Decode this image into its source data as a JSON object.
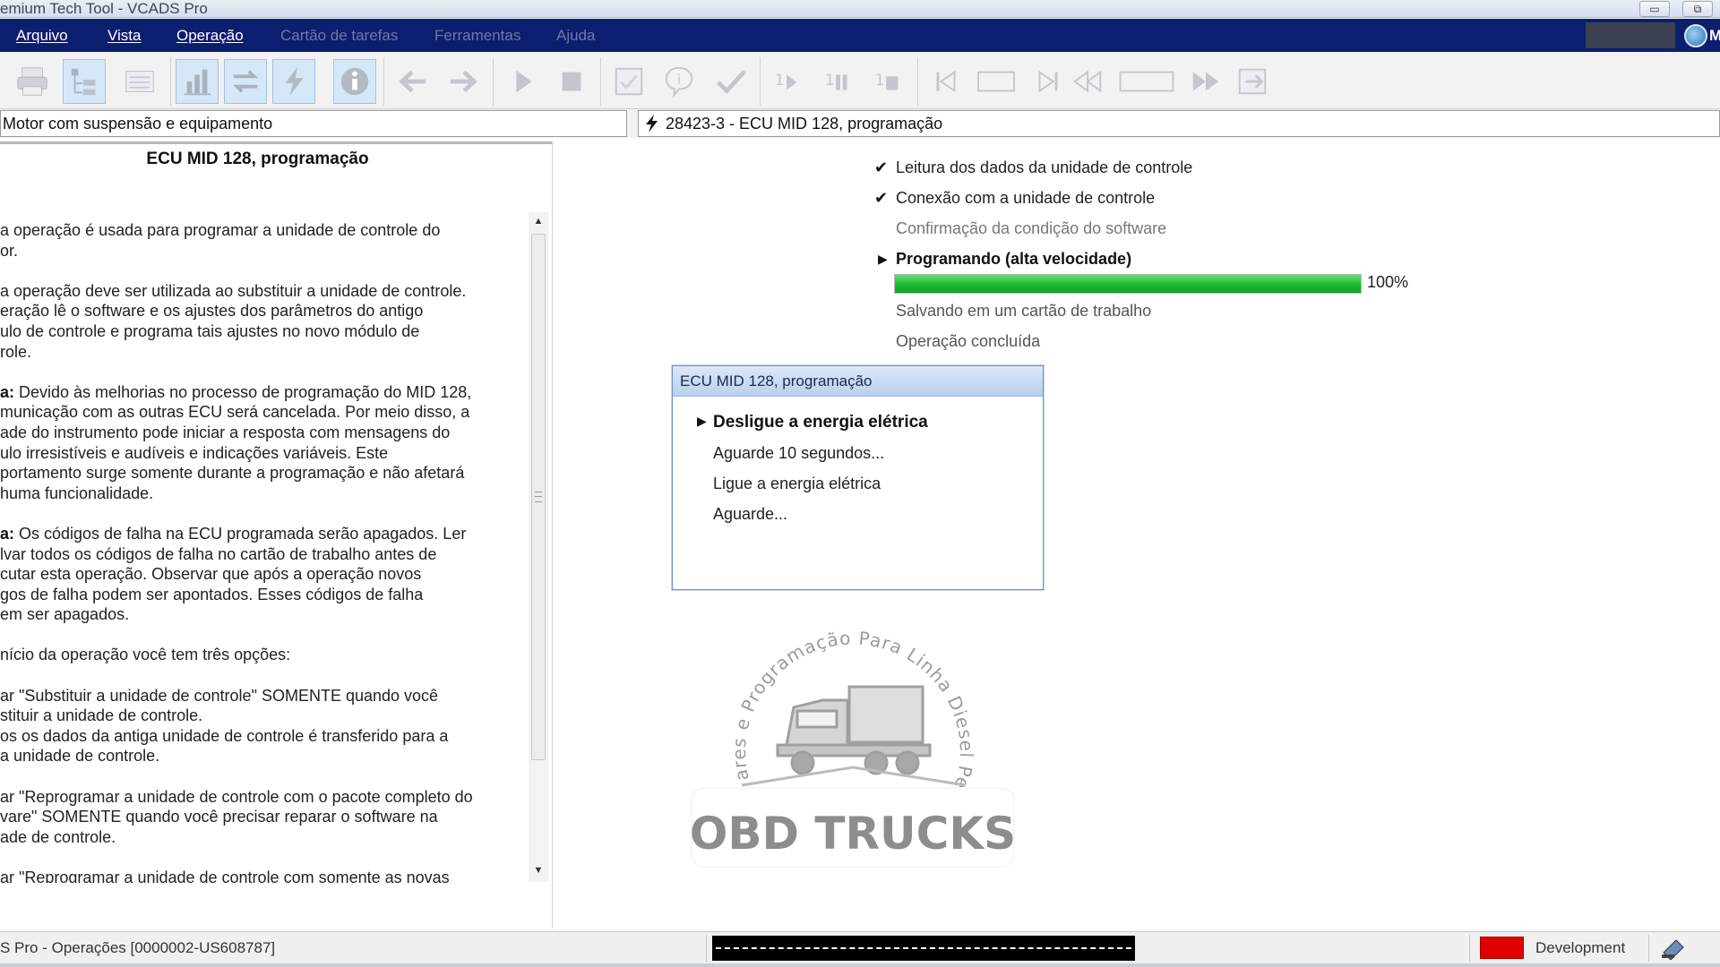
{
  "window": {
    "title": "emium Tech Tool - VCADS Pro",
    "minimize_label": "▭",
    "restore_label": "⧉"
  },
  "menu": {
    "items": [
      "Arquivo",
      "Vista",
      "Operação",
      "Cartão de tarefas",
      "Ferramentas",
      "Ajuda"
    ],
    "enabled": [
      true,
      true,
      true,
      false,
      false,
      false
    ],
    "right_letter": "M"
  },
  "toolbar": {
    "icons": [
      "printer-icon",
      "tree-icon",
      "list-icon",
      "bar-chart-icon",
      "swap-arrows-icon",
      "bolt-icon",
      "info-icon",
      "back-arrow-icon",
      "forward-arrow-icon",
      "play-icon",
      "stop-icon",
      "checklist-icon",
      "hint-icon",
      "checkmark-icon",
      "step-play-icon",
      "step-pause-icon",
      "step-stop-icon",
      "first-icon",
      "frame-icon",
      "last-icon",
      "rewind-icon",
      "frame2-icon",
      "fast-forward-icon",
      "export-icon"
    ],
    "active": [
      "tree-icon",
      "bar-chart-icon",
      "swap-arrows-icon",
      "bolt-icon",
      "info-icon"
    ]
  },
  "breadcrumb": {
    "left": "Motor com suspensão e equipamento",
    "right": "28423-3 - ECU MID 128, programação"
  },
  "document": {
    "title": "ECU MID 128, programação",
    "lines": [
      [
        "a operação é usada para programar a unidade de controle do",
        "or."
      ],
      [
        "a operação deve ser utilizada ao substituir a unidade de controle.",
        "eração lê o software e os ajustes dos parâmetros do antigo",
        "ulo de controle e programa tais ajustes no novo módulo de",
        "role."
      ],
      [
        "a: Devido às melhorias no processo de programação do MID 128,",
        "municação com as outras ECU será cancelada. Por meio disso, a",
        "ade do instrumento pode iniciar a resposta com mensagens do",
        "ulo irresistíveis e audíveis e indicações variáveis. Este",
        "portamento surge somente durante a programação e não afetará",
        "huma funcionalidade."
      ],
      [
        "a: Os códigos de falha na ECU programada serão apagados. Ler",
        "lvar todos os códigos de falha no cartão de trabalho antes de",
        "cutar esta operação. Observar que após a operação novos",
        "gos de falha podem ser apontados. Esses códigos de falha",
        "em ser apagados."
      ],
      [
        "nício da operação você tem três opções:"
      ],
      [
        "ar \"Substituir a unidade de controle\" SOMENTE quando você",
        "stituir a unidade de controle.",
        "os os dados da antiga unidade de controle é transferido para a",
        "a unidade de controle."
      ],
      [
        "ar \"Reprogramar a unidade de controle com o pacote completo do",
        "vare\" SOMENTE quando você precisar reparar o software na",
        "ade de controle."
      ],
      [
        "ar \"Reprogramar a unidade de controle com somente as novas"
      ]
    ]
  },
  "steps": [
    {
      "label": "Leitura dos dados da unidade de controle",
      "state": "done",
      "mark": "✔"
    },
    {
      "label": "Conexão com a unidade de controle",
      "state": "done",
      "mark": "✔"
    },
    {
      "label": "Confirmação da condição do software",
      "state": "dim",
      "mark": ""
    },
    {
      "label": "Programando (alta velocidade)",
      "state": "current",
      "mark": "▶"
    },
    {
      "label": "Salvando em um cartão de trabalho",
      "state": "pending",
      "mark": ""
    },
    {
      "label": "Operação concluída",
      "state": "pending",
      "mark": ""
    }
  ],
  "progress": {
    "fraction": 1.0,
    "label": "100%",
    "color": "#1db831"
  },
  "dialog": {
    "title": "ECU MID 128, programação",
    "steps": [
      {
        "label": "Desligue a energia elétrica",
        "state": "current",
        "mark": "▶"
      },
      {
        "label": "Aguarde 10 segundos...",
        "state": "pending",
        "mark": ""
      },
      {
        "label": "Ligue a energia elétrica",
        "state": "pending",
        "mark": ""
      },
      {
        "label": "Aguarde...",
        "state": "pending",
        "mark": ""
      }
    ]
  },
  "watermark": {
    "arc_text": "Softwares e Programação Para Linha Diesel Pesado",
    "brand": "OBD TRUCKS"
  },
  "statusbar": {
    "left": "S Pro - Operações   [0000002-US608787]",
    "environment_label": "Development",
    "environment_color": "#e00000"
  }
}
